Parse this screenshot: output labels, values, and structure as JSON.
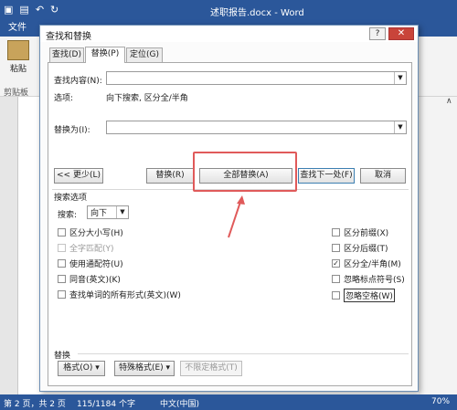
{
  "word": {
    "window_title": "述职报告.docx - Word",
    "file_tab": "文件",
    "paste_label": "粘贴",
    "clipboard_label": "剪贴板"
  },
  "status": {
    "page": "第 2 页，共 2 页",
    "words": "115/1184 个字",
    "language": "中文(中国)",
    "zoom": "70%"
  },
  "dialog": {
    "title": "查找和替换",
    "help_label": "?",
    "close_label": "✕",
    "tabs": [
      {
        "label": "查找(D)",
        "active": false
      },
      {
        "label": "替换(P)",
        "active": true
      },
      {
        "label": "定位(G)",
        "active": false
      }
    ],
    "find_label": "查找内容(N):",
    "find_value": "",
    "options_label": "选项:",
    "options_value": "向下搜索, 区分全/半角",
    "replace_label": "替换为(I):",
    "replace_value": "",
    "buttons": {
      "less": "<< 更少(L)",
      "replace": "替换(R)",
      "replace_all": "全部替换(A)",
      "find_next": "查找下一处(F)",
      "cancel": "取消"
    },
    "search_options_title": "搜索选项",
    "search_label": "搜索:",
    "search_direction": "向下",
    "left_checks": [
      {
        "label": "区分大小写(H)",
        "checked": false,
        "disabled": false
      },
      {
        "label": "全字匹配(Y)",
        "checked": false,
        "disabled": true
      },
      {
        "label": "使用通配符(U)",
        "checked": false,
        "disabled": false
      },
      {
        "label": "同音(英文)(K)",
        "checked": false,
        "disabled": false
      },
      {
        "label": "查找单词的所有形式(英文)(W)",
        "checked": false,
        "disabled": false
      }
    ],
    "right_checks": [
      {
        "label": "区分前缀(X)",
        "checked": false
      },
      {
        "label": "区分后缀(T)",
        "checked": false
      },
      {
        "label": "区分全/半角(M)",
        "checked": true
      },
      {
        "label": "忽略标点符号(S)",
        "checked": false
      },
      {
        "label": "忽略空格(W)",
        "checked": false
      }
    ],
    "replace_section_title": "替换",
    "format_button": "格式(O) ▾",
    "special_button": "特殊格式(E) ▾",
    "no_format_button": "不限定格式(T)"
  }
}
